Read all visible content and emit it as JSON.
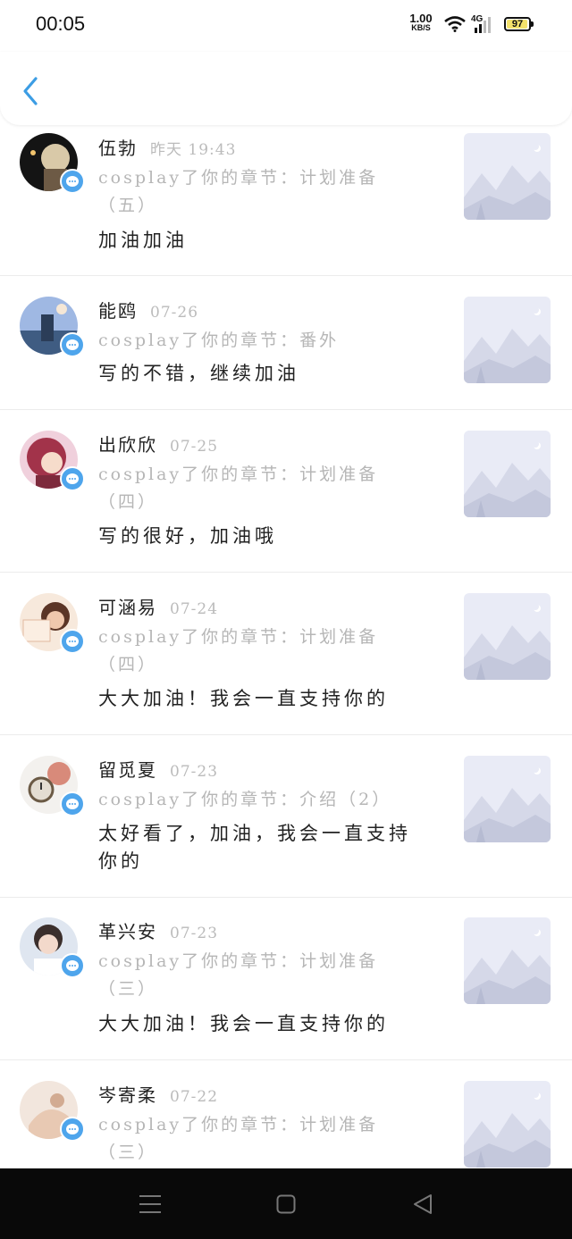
{
  "status_bar": {
    "time": "00:05",
    "net_speed_value": "1.00",
    "net_speed_unit": "KB/S",
    "signal_label": "4G",
    "battery_level": "97",
    "battery_fraction": 0.97
  },
  "header": {
    "back_icon": "chevron-left-icon"
  },
  "comments": [
    {
      "username": "伍勃",
      "time": "昨天 19:43",
      "ref": "cosplay了你的章节：计划准备（五）",
      "message": "加油加油"
    },
    {
      "username": "能鸥",
      "time": "07-26",
      "ref": "cosplay了你的章节：番外",
      "message": "写的不错，继续加油"
    },
    {
      "username": "出欣欣",
      "time": "07-25",
      "ref": "cosplay了你的章节：计划准备（四）",
      "message": "写的很好，加油哦"
    },
    {
      "username": "可涵易",
      "time": "07-24",
      "ref": "cosplay了你的章节：计划准备（四）",
      "message": "大大加油！我会一直支持你的"
    },
    {
      "username": "留觅夏",
      "time": "07-23",
      "ref": "cosplay了你的章节：介绍（2）",
      "message": "太好看了，加油，我会一直支持你的"
    },
    {
      "username": "革兴安",
      "time": "07-23",
      "ref": "cosplay了你的章节：计划准备（三）",
      "message": "大大加油！我会一直支持你的"
    },
    {
      "username": "岑寄柔",
      "time": "07-22",
      "ref": "cosplay了你的章节：计划准备（三）",
      "message": ""
    }
  ],
  "nav": {
    "menu_icon": "menu-icon",
    "home_icon": "home-square-icon",
    "back_icon": "back-triangle-icon"
  }
}
